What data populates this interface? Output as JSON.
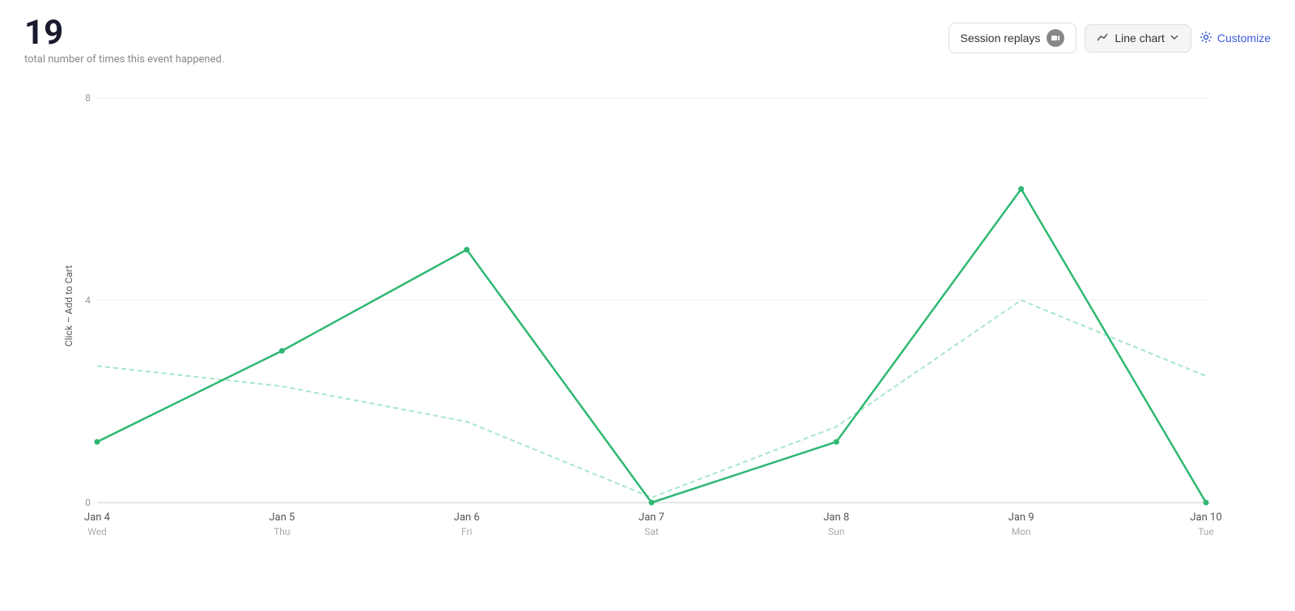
{
  "header": {
    "metric_number": "19",
    "metric_subtitle": "total number of times this event happened.",
    "session_replays_label": "Session replays",
    "line_chart_label": "Line chart",
    "customize_label": "Customize"
  },
  "chart": {
    "y_axis_label": "Click – Add to Cart",
    "y_ticks": [
      0,
      4,
      8
    ],
    "x_labels": [
      {
        "date": "Jan 4",
        "day": "Wed"
      },
      {
        "date": "Jan 5",
        "day": "Thu"
      },
      {
        "date": "Jan 6",
        "day": "Fri"
      },
      {
        "date": "Jan 7",
        "day": "Sat"
      },
      {
        "date": "Jan 8",
        "day": "Sun"
      },
      {
        "date": "Jan 9",
        "day": "Mon"
      },
      {
        "date": "Jan 10",
        "day": "Tue"
      }
    ],
    "series_solid": [
      {
        "x": 0,
        "y": 1.2
      },
      {
        "x": 1,
        "y": 3.0
      },
      {
        "x": 2,
        "y": 5.0
      },
      {
        "x": 3,
        "y": 0
      },
      {
        "x": 4,
        "y": 1.2
      },
      {
        "x": 5,
        "y": 6.2
      },
      {
        "x": 6,
        "y": 0
      }
    ],
    "series_dashed": [
      {
        "x": 0,
        "y": 2.7
      },
      {
        "x": 1,
        "y": 2.3
      },
      {
        "x": 2,
        "y": 1.6
      },
      {
        "x": 3,
        "y": 0.1
      },
      {
        "x": 4,
        "y": 1.5
      },
      {
        "x": 5,
        "y": 4.0
      },
      {
        "x": 6,
        "y": 2.5
      }
    ],
    "y_max": 8,
    "colors": {
      "solid": "#2eb872",
      "dashed": "#a8e6c8",
      "grid": "#eeeeee",
      "axis": "#cccccc"
    }
  }
}
